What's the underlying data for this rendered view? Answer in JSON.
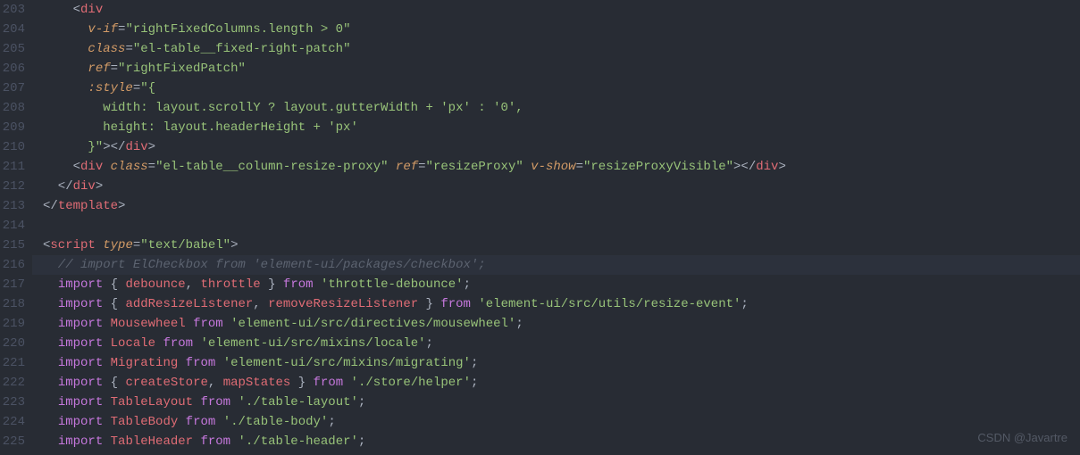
{
  "lineNumbers": [
    "203",
    "204",
    "205",
    "206",
    "207",
    "208",
    "209",
    "210",
    "211",
    "212",
    "213",
    "214",
    "215",
    "216",
    "217",
    "218",
    "219",
    "220",
    "221",
    "222",
    "223",
    "224",
    "225"
  ],
  "lines": [
    [
      {
        "cls": "p",
        "t": "    <"
      },
      {
        "cls": "t",
        "t": "div"
      }
    ],
    [
      {
        "cls": "p",
        "t": "      "
      },
      {
        "cls": "ai",
        "t": "v-if"
      },
      {
        "cls": "p",
        "t": "="
      },
      {
        "cls": "s",
        "t": "\"rightFixedColumns.length > 0\""
      }
    ],
    [
      {
        "cls": "p",
        "t": "      "
      },
      {
        "cls": "ai",
        "t": "class"
      },
      {
        "cls": "p",
        "t": "="
      },
      {
        "cls": "s",
        "t": "\"el-table__fixed-right-patch\""
      }
    ],
    [
      {
        "cls": "p",
        "t": "      "
      },
      {
        "cls": "ai",
        "t": "ref"
      },
      {
        "cls": "p",
        "t": "="
      },
      {
        "cls": "s",
        "t": "\"rightFixedPatch\""
      }
    ],
    [
      {
        "cls": "p",
        "t": "      "
      },
      {
        "cls": "ai",
        "t": ":style"
      },
      {
        "cls": "p",
        "t": "="
      },
      {
        "cls": "s",
        "t": "\"{"
      }
    ],
    [
      {
        "cls": "s",
        "t": "        width: layout.scrollY ? layout.gutterWidth + 'px' : '0',"
      }
    ],
    [
      {
        "cls": "s",
        "t": "        height: layout.headerHeight + 'px'"
      }
    ],
    [
      {
        "cls": "s",
        "t": "      }\""
      },
      {
        "cls": "p",
        "t": "></"
      },
      {
        "cls": "t",
        "t": "div"
      },
      {
        "cls": "p",
        "t": ">"
      }
    ],
    [
      {
        "cls": "p",
        "t": "    <"
      },
      {
        "cls": "t",
        "t": "div"
      },
      {
        "cls": "p",
        "t": " "
      },
      {
        "cls": "ai",
        "t": "class"
      },
      {
        "cls": "p",
        "t": "="
      },
      {
        "cls": "s",
        "t": "\"el-table__column-resize-proxy\""
      },
      {
        "cls": "p",
        "t": " "
      },
      {
        "cls": "ai",
        "t": "ref"
      },
      {
        "cls": "p",
        "t": "="
      },
      {
        "cls": "s",
        "t": "\"resizeProxy\""
      },
      {
        "cls": "p",
        "t": " "
      },
      {
        "cls": "ai",
        "t": "v-show"
      },
      {
        "cls": "p",
        "t": "="
      },
      {
        "cls": "s",
        "t": "\"resizeProxyVisible\""
      },
      {
        "cls": "p",
        "t": "></"
      },
      {
        "cls": "t",
        "t": "div"
      },
      {
        "cls": "p",
        "t": ">"
      }
    ],
    [
      {
        "cls": "p",
        "t": "  </"
      },
      {
        "cls": "t",
        "t": "div"
      },
      {
        "cls": "p",
        "t": ">"
      }
    ],
    [
      {
        "cls": "p",
        "t": "</"
      },
      {
        "cls": "t",
        "t": "template"
      },
      {
        "cls": "p",
        "t": ">"
      }
    ],
    [],
    [
      {
        "cls": "p",
        "t": "<"
      },
      {
        "cls": "t",
        "t": "script"
      },
      {
        "cls": "p",
        "t": " "
      },
      {
        "cls": "ai",
        "t": "type"
      },
      {
        "cls": "p",
        "t": "="
      },
      {
        "cls": "s",
        "t": "\"text/babel\""
      },
      {
        "cls": "p",
        "t": ">"
      }
    ],
    [
      {
        "cls": "c",
        "t": "  // import ElCheckbox from 'element-ui/packages/checkbox';"
      }
    ],
    [
      {
        "cls": "p",
        "t": "  "
      },
      {
        "cls": "k",
        "t": "import"
      },
      {
        "cls": "p",
        "t": " { "
      },
      {
        "cls": "v",
        "t": "debounce"
      },
      {
        "cls": "p",
        "t": ", "
      },
      {
        "cls": "v",
        "t": "throttle"
      },
      {
        "cls": "p",
        "t": " } "
      },
      {
        "cls": "k",
        "t": "from"
      },
      {
        "cls": "p",
        "t": " "
      },
      {
        "cls": "s",
        "t": "'throttle-debounce'"
      },
      {
        "cls": "p",
        "t": ";"
      }
    ],
    [
      {
        "cls": "p",
        "t": "  "
      },
      {
        "cls": "k",
        "t": "import"
      },
      {
        "cls": "p",
        "t": " { "
      },
      {
        "cls": "v",
        "t": "addResizeListener"
      },
      {
        "cls": "p",
        "t": ", "
      },
      {
        "cls": "v",
        "t": "removeResizeListener"
      },
      {
        "cls": "p",
        "t": " } "
      },
      {
        "cls": "k",
        "t": "from"
      },
      {
        "cls": "p",
        "t": " "
      },
      {
        "cls": "s",
        "t": "'element-ui/src/utils/resize-event'"
      },
      {
        "cls": "p",
        "t": ";"
      }
    ],
    [
      {
        "cls": "p",
        "t": "  "
      },
      {
        "cls": "k",
        "t": "import"
      },
      {
        "cls": "p",
        "t": " "
      },
      {
        "cls": "v",
        "t": "Mousewheel"
      },
      {
        "cls": "p",
        "t": " "
      },
      {
        "cls": "k",
        "t": "from"
      },
      {
        "cls": "p",
        "t": " "
      },
      {
        "cls": "s",
        "t": "'element-ui/src/directives/mousewheel'"
      },
      {
        "cls": "p",
        "t": ";"
      }
    ],
    [
      {
        "cls": "p",
        "t": "  "
      },
      {
        "cls": "k",
        "t": "import"
      },
      {
        "cls": "p",
        "t": " "
      },
      {
        "cls": "v",
        "t": "Locale"
      },
      {
        "cls": "p",
        "t": " "
      },
      {
        "cls": "k",
        "t": "from"
      },
      {
        "cls": "p",
        "t": " "
      },
      {
        "cls": "s",
        "t": "'element-ui/src/mixins/locale'"
      },
      {
        "cls": "p",
        "t": ";"
      }
    ],
    [
      {
        "cls": "p",
        "t": "  "
      },
      {
        "cls": "k",
        "t": "import"
      },
      {
        "cls": "p",
        "t": " "
      },
      {
        "cls": "v",
        "t": "Migrating"
      },
      {
        "cls": "p",
        "t": " "
      },
      {
        "cls": "k",
        "t": "from"
      },
      {
        "cls": "p",
        "t": " "
      },
      {
        "cls": "s",
        "t": "'element-ui/src/mixins/migrating'"
      },
      {
        "cls": "p",
        "t": ";"
      }
    ],
    [
      {
        "cls": "p",
        "t": "  "
      },
      {
        "cls": "k",
        "t": "import"
      },
      {
        "cls": "p",
        "t": " { "
      },
      {
        "cls": "v",
        "t": "createStore"
      },
      {
        "cls": "p",
        "t": ", "
      },
      {
        "cls": "v",
        "t": "mapStates"
      },
      {
        "cls": "p",
        "t": " } "
      },
      {
        "cls": "k",
        "t": "from"
      },
      {
        "cls": "p",
        "t": " "
      },
      {
        "cls": "s",
        "t": "'./store/helper'"
      },
      {
        "cls": "p",
        "t": ";"
      }
    ],
    [
      {
        "cls": "p",
        "t": "  "
      },
      {
        "cls": "k",
        "t": "import"
      },
      {
        "cls": "p",
        "t": " "
      },
      {
        "cls": "v",
        "t": "TableLayout"
      },
      {
        "cls": "p",
        "t": " "
      },
      {
        "cls": "k",
        "t": "from"
      },
      {
        "cls": "p",
        "t": " "
      },
      {
        "cls": "s",
        "t": "'./table-layout'"
      },
      {
        "cls": "p",
        "t": ";"
      }
    ],
    [
      {
        "cls": "p",
        "t": "  "
      },
      {
        "cls": "k",
        "t": "import"
      },
      {
        "cls": "p",
        "t": " "
      },
      {
        "cls": "v",
        "t": "TableBody"
      },
      {
        "cls": "p",
        "t": " "
      },
      {
        "cls": "k",
        "t": "from"
      },
      {
        "cls": "p",
        "t": " "
      },
      {
        "cls": "s",
        "t": "'./table-body'"
      },
      {
        "cls": "p",
        "t": ";"
      }
    ],
    [
      {
        "cls": "p",
        "t": "  "
      },
      {
        "cls": "k",
        "t": "import"
      },
      {
        "cls": "p",
        "t": " "
      },
      {
        "cls": "v",
        "t": "TableHeader"
      },
      {
        "cls": "p",
        "t": " "
      },
      {
        "cls": "k",
        "t": "from"
      },
      {
        "cls": "p",
        "t": " "
      },
      {
        "cls": "s",
        "t": "'./table-header'"
      },
      {
        "cls": "p",
        "t": ";"
      }
    ]
  ],
  "highlightedLine": 13,
  "watermark": "CSDN @Javartre"
}
